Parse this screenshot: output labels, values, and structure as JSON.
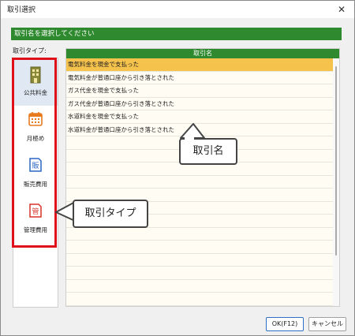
{
  "window": {
    "title": "取引選択",
    "close_label": "✕"
  },
  "banner": {
    "text": "取引名を選択してください"
  },
  "types": {
    "label": "取引タイプ:",
    "items": [
      {
        "label": "公共料金",
        "icon": "building-icon",
        "color": "#7a7a2a"
      },
      {
        "label": "月極め",
        "icon": "calendar-icon",
        "color": "#e87a1e"
      },
      {
        "label": "販売費用",
        "icon": "sales-expense-icon",
        "glyph": "販",
        "color": "#2a66c4"
      },
      {
        "label": "管理費用",
        "icon": "admin-expense-icon",
        "glyph": "管",
        "color": "#d9342b"
      }
    ]
  },
  "list": {
    "header": "取引名",
    "rows": [
      "電気料金を現金で支払った",
      "電気料金が普通口座から引き落とされた",
      "ガス代金を現金で支払った",
      "ガス代金が普通口座から引き落とされた",
      "水道料金を現金で支払った",
      "水道料金が普通口座から引き落とされた"
    ],
    "selected_index": 0
  },
  "callouts": {
    "name": "取引名",
    "type": "取引タイプ"
  },
  "buttons": {
    "ok": "OK(F12)",
    "cancel": "キャンセル"
  },
  "colors": {
    "accent_green": "#2f8a2f",
    "selected_row": "#f5c24c",
    "highlight_box": "#e0101a"
  }
}
